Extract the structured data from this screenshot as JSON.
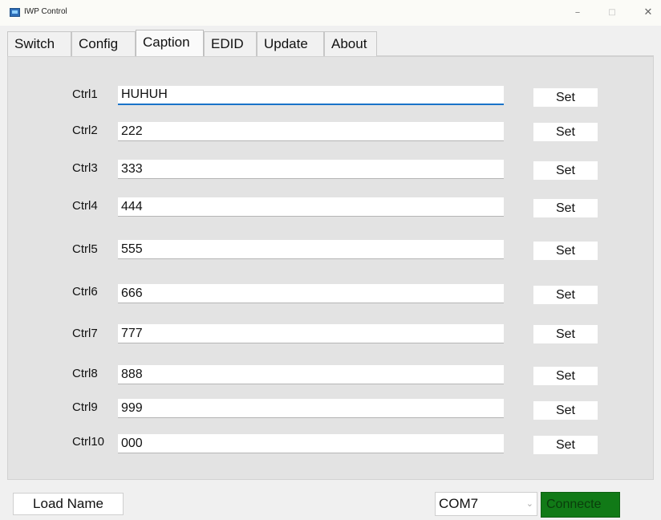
{
  "window": {
    "title": "IWP Control",
    "caption_minimize": "–",
    "caption_maximize": "□",
    "caption_close": "✕"
  },
  "tabs": [
    {
      "label": "Switch"
    },
    {
      "label": "Config"
    },
    {
      "label": "Caption",
      "active": true
    },
    {
      "label": "EDID"
    },
    {
      "label": "Update"
    },
    {
      "label": "About"
    }
  ],
  "rows": [
    {
      "label": "Ctrl1",
      "value": "HUHUH",
      "button": "Set"
    },
    {
      "label": "Ctrl2",
      "value": "222",
      "button": "Set"
    },
    {
      "label": "Ctrl3",
      "value": "333",
      "button": "Set"
    },
    {
      "label": "Ctrl4",
      "value": "444",
      "button": "Set"
    },
    {
      "label": "Ctrl5",
      "value": "555",
      "button": "Set"
    },
    {
      "label": "Ctrl6",
      "value": "666",
      "button": "Set"
    },
    {
      "label": "Ctrl7",
      "value": "777",
      "button": "Set"
    },
    {
      "label": "Ctrl8",
      "value": "888",
      "button": "Set"
    },
    {
      "label": "Ctrl9",
      "value": "999",
      "button": "Set"
    },
    {
      "label": "Ctrl10",
      "value": "000",
      "button": "Set"
    }
  ],
  "bottom": {
    "load_name": "Load Name",
    "com_port": "COM7",
    "com_arrow_icon": "chevron-down-icon",
    "connect": "Connecte"
  },
  "colors": {
    "connect_bg": "#117a17",
    "focus_accent": "#1a73c9",
    "panel_bg": "#e3e3e3"
  }
}
